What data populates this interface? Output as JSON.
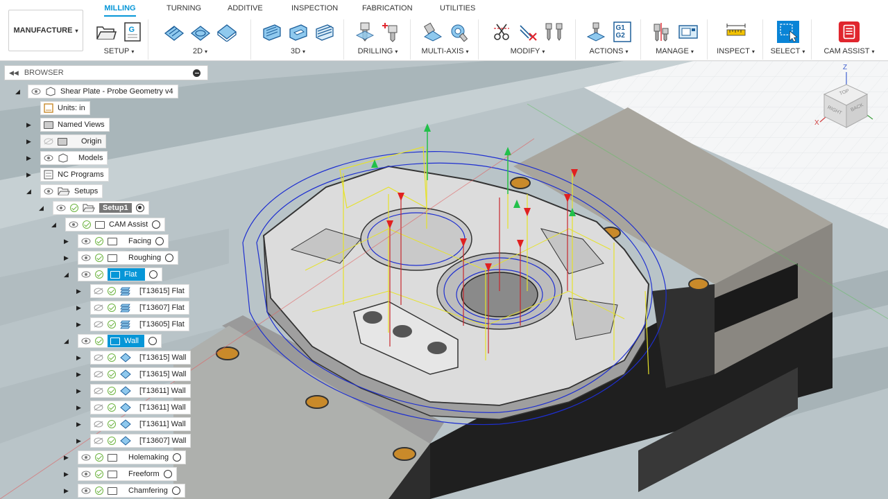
{
  "workspace": {
    "label": "MANUFACTURE"
  },
  "tabs": [
    "MILLING",
    "TURNING",
    "ADDITIVE",
    "INSPECTION",
    "FABRICATION",
    "UTILITIES"
  ],
  "active_tab": "MILLING",
  "groups": {
    "setup": "SETUP",
    "two_d": "2D",
    "three_d": "3D",
    "drilling": "DRILLING",
    "multi_axis": "MULTI-AXIS",
    "modify": "MODIFY",
    "actions": "ACTIONS",
    "manage": "MANAGE",
    "inspect": "INSPECT",
    "select": "SELECT",
    "cam_assist": "CAM ASSIST"
  },
  "icons": {
    "nc_program_text": "G",
    "post_text_1": "G1",
    "post_text_2": "G2"
  },
  "browser": {
    "title": "BROWSER",
    "nodes": {
      "root": "Shear Plate - Probe Geometry v4",
      "units": "Units: in",
      "named_views": "Named Views",
      "origin": "Origin",
      "models": "Models",
      "nc_programs": "NC Programs",
      "setups": "Setups",
      "setup1": "Setup1",
      "cam_assist": "CAM Assist",
      "facing": "Facing",
      "roughing": "Roughing",
      "flat": "Flat",
      "flat_ops": [
        "[T13615] Flat",
        "[T13607] Flat",
        "[T13605] Flat"
      ],
      "wall": "Wall",
      "wall_ops": [
        "[T13615] Wall",
        "[T13615] Wall",
        "[T13611] Wall",
        "[T13611] Wall",
        "[T13611] Wall",
        "[T13607] Wall"
      ],
      "holemaking": "Holemaking",
      "freeform": "Freeform",
      "chamfering": "Chamfering"
    }
  },
  "viewcube": {
    "top": "TOP",
    "right": "RIGHT",
    "back": "BACK",
    "axis_z": "Z",
    "axis_x": "X"
  },
  "colors": {
    "accent": "#0696d7",
    "toolpath_blue": "#1e2fd0",
    "toolpath_yellow": "#e6e22a",
    "check_green": "#6cb33e",
    "select_icon": "#0a84d6",
    "cam_assist_icon": "#e0262e"
  }
}
